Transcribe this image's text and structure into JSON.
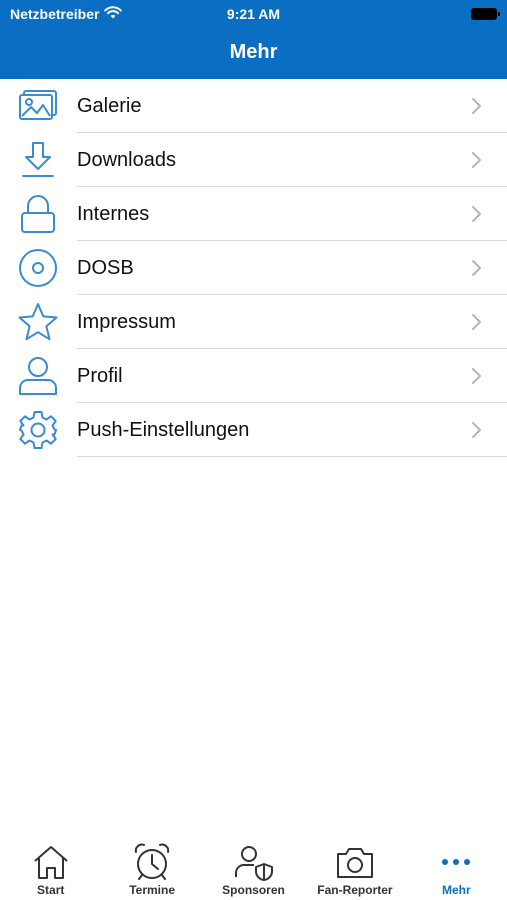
{
  "status_bar": {
    "carrier": "Netzbetreiber",
    "time": "9:21 AM"
  },
  "header": {
    "title": "Mehr"
  },
  "colors": {
    "accent": "#0a6fc2",
    "separator": "#d9d9d9"
  },
  "menu": {
    "items": [
      {
        "label": "Galerie",
        "icon": "gallery-icon"
      },
      {
        "label": "Downloads",
        "icon": "download-icon"
      },
      {
        "label": "Internes",
        "icon": "lock-icon"
      },
      {
        "label": "DOSB",
        "icon": "disc-icon"
      },
      {
        "label": "Impressum",
        "icon": "star-icon"
      },
      {
        "label": "Profil",
        "icon": "user-icon"
      },
      {
        "label": "Push-Einstellungen",
        "icon": "gear-icon"
      }
    ]
  },
  "tabs": [
    {
      "label": "Start",
      "icon": "home-icon",
      "active": false
    },
    {
      "label": "Termine",
      "icon": "alarm-clock-icon",
      "active": false
    },
    {
      "label": "Sponsoren",
      "icon": "sponsor-user-shield-icon",
      "active": false
    },
    {
      "label": "Fan-Reporter",
      "icon": "camera-icon",
      "active": false
    },
    {
      "label": "Mehr",
      "icon": "more-dots-icon",
      "active": true
    }
  ]
}
